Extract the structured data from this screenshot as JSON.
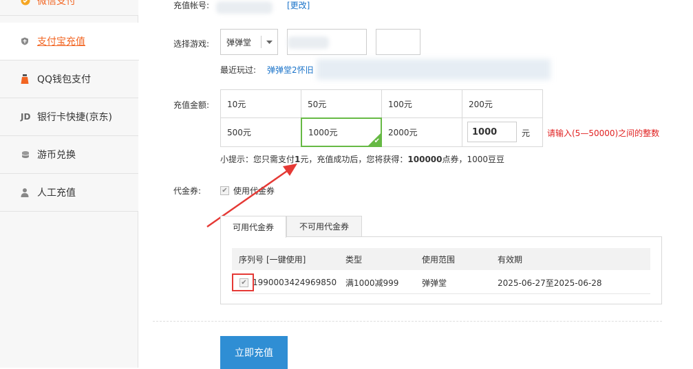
{
  "sidebar": {
    "items": [
      {
        "label": "微信支付",
        "icon": "wechat-icon"
      },
      {
        "label": "支付宝充值",
        "icon": "alipay-icon"
      },
      {
        "label": "QQ钱包支付",
        "icon": "qq-wallet-icon"
      },
      {
        "label": "银行卡快捷(京东)",
        "icon": "jd-icon",
        "icon_text": "JD"
      },
      {
        "label": "游币兑换",
        "icon": "coin-icon"
      },
      {
        "label": "人工充值",
        "icon": "person-icon"
      }
    ]
  },
  "account": {
    "label": "充值帐号:",
    "change_link": "[更改]"
  },
  "game": {
    "label": "选择游戏:",
    "selected": "弹弹堂",
    "recent_label": "最近玩过:",
    "recent_value": "弹弹堂2怀旧"
  },
  "amount": {
    "label": "充值金额:",
    "options": [
      "10元",
      "50元",
      "100元",
      "200元",
      "500元",
      "1000元",
      "2000元"
    ],
    "custom_value": "1000",
    "custom_unit": "元",
    "hint_error": "请输入(5—50000)之间的整数",
    "tip_prefix": "小提示：您只需支付",
    "tip_pay": "1",
    "tip_mid": "元，充值成功后，您将获得：",
    "tip_points": "100000",
    "tip_suffix": "点券，1000豆豆"
  },
  "voucher": {
    "label": "代金券:",
    "use_label": "使用代金券",
    "tabs": [
      "可用代金券",
      "不可用代金券"
    ],
    "headers": {
      "serial": "序列号",
      "one_click": "[一键使用]",
      "type": "类型",
      "scope": "使用范围",
      "validity": "有效期"
    },
    "rows": [
      {
        "serial": "1990003424969850",
        "type": "满1000减999",
        "scope": "弹弹堂",
        "validity": "2025-06-27至2025-06-28"
      }
    ]
  },
  "submit_label": "立即充值",
  "colors": {
    "accent_orange": "#f26522",
    "link_blue": "#1a73c9",
    "select_green": "#66b944",
    "button_blue": "#2f8ed4",
    "error_red": "#e02020",
    "annotation_red": "#e53935"
  }
}
